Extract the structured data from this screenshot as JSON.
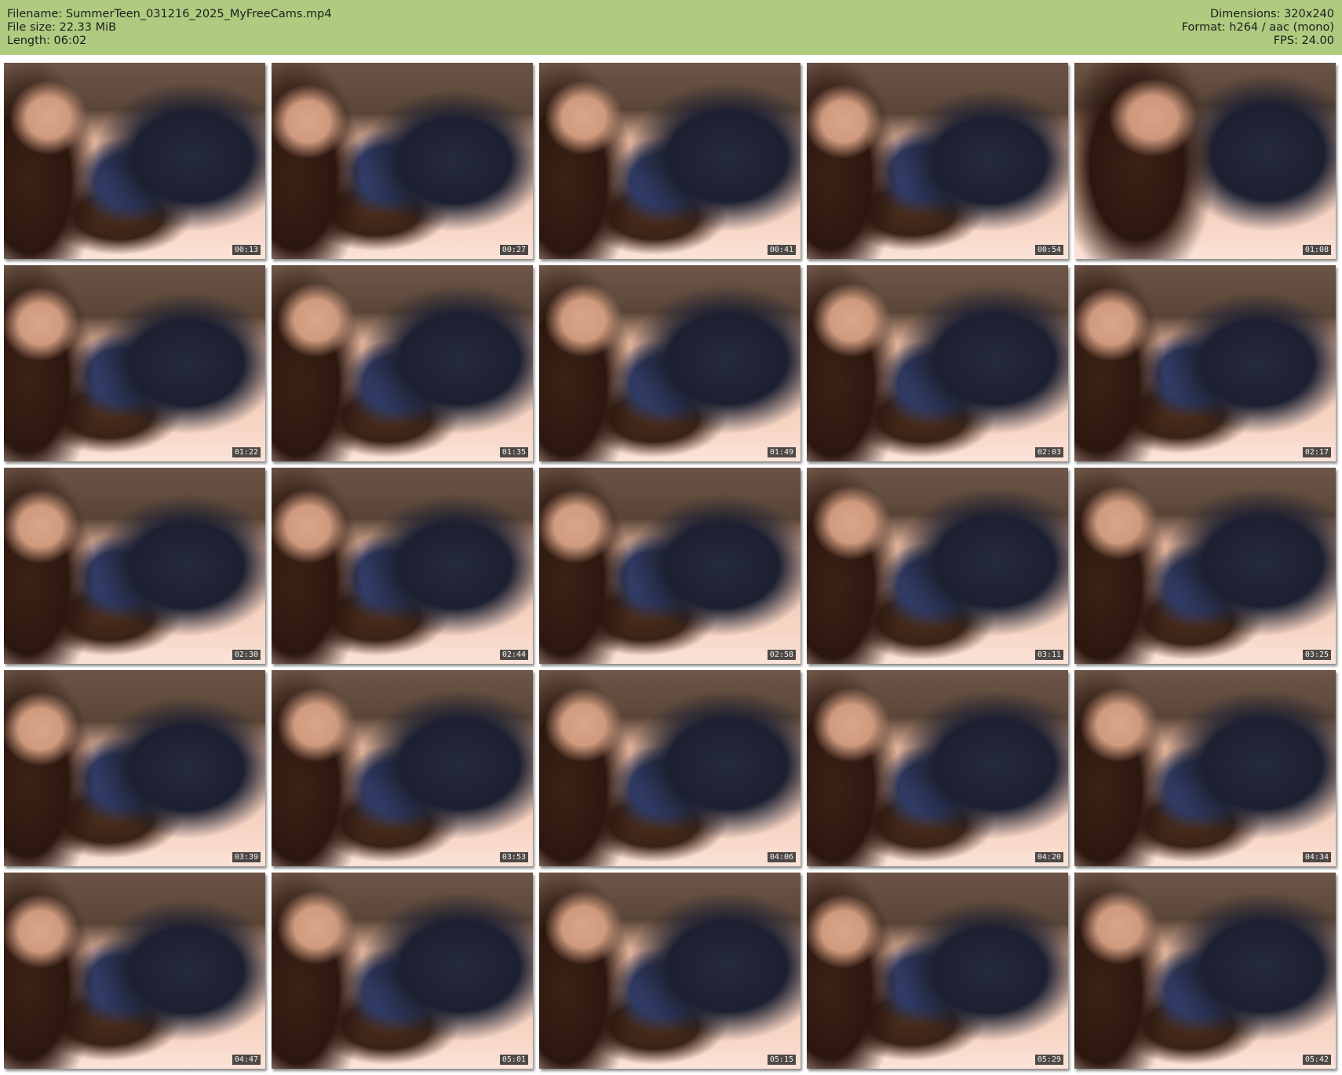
{
  "header": {
    "filename": "Filename: SummerTeen_031216_2025_MyFreeCams.mp4",
    "file_size": "File size: 22.33 MiB",
    "length": "Length: 06:02",
    "dimensions": "Dimensions: 320x240",
    "format": "Format: h264 / aac (mono)",
    "fps": "FPS: 24.00"
  },
  "thumbnails": [
    {
      "timestamp": "00:13"
    },
    {
      "timestamp": "00:27"
    },
    {
      "timestamp": "00:41"
    },
    {
      "timestamp": "00:54"
    },
    {
      "timestamp": "01:08"
    },
    {
      "timestamp": "01:22"
    },
    {
      "timestamp": "01:35"
    },
    {
      "timestamp": "01:49"
    },
    {
      "timestamp": "02:03"
    },
    {
      "timestamp": "02:17"
    },
    {
      "timestamp": "02:30"
    },
    {
      "timestamp": "02:44"
    },
    {
      "timestamp": "02:58"
    },
    {
      "timestamp": "03:11"
    },
    {
      "timestamp": "03:25"
    },
    {
      "timestamp": "03:39"
    },
    {
      "timestamp": "03:53"
    },
    {
      "timestamp": "04:06"
    },
    {
      "timestamp": "04:20"
    },
    {
      "timestamp": "04:34"
    },
    {
      "timestamp": "04:47"
    },
    {
      "timestamp": "05:01"
    },
    {
      "timestamp": "05:15"
    },
    {
      "timestamp": "05:29"
    },
    {
      "timestamp": "05:42"
    }
  ],
  "colors": {
    "header_background": "#afcb80",
    "header_text": "#1c1c1c",
    "timestamp_background": "#1e1e1e",
    "timestamp_text": "#f2f2f2"
  }
}
